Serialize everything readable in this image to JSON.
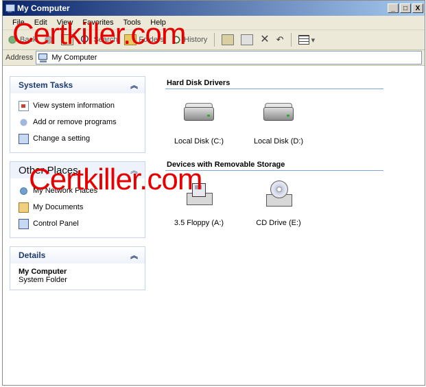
{
  "window": {
    "title": "My Computer",
    "controls": {
      "minimize": "_",
      "maximize": "□",
      "close": "X"
    }
  },
  "menu": [
    "File",
    "Edit",
    "View",
    "Favorites",
    "Tools",
    "Help"
  ],
  "toolbar": {
    "back": "Back",
    "search": "Search",
    "folders": "Folders",
    "history": "History"
  },
  "address": {
    "label": "Address",
    "value": "My Computer"
  },
  "left_panels": {
    "system_tasks": {
      "title": "System Tasks",
      "items": [
        "View system information",
        "Add or remove programs",
        "Change a setting"
      ]
    },
    "other_places": {
      "title": "Other Places",
      "items": [
        "My Network Places",
        "My Documents",
        "Control Panel"
      ]
    },
    "details": {
      "title": "Details",
      "name": "My Computer",
      "type": "System Folder"
    }
  },
  "groups": {
    "hard_disks": {
      "title": "Hard Disk Drivers",
      "items": [
        "Local Disk (C:)",
        "Local Disk (D:)"
      ]
    },
    "removable": {
      "title": "Devices with Removable Storage",
      "items": [
        "3.5 Floppy (A:)",
        "CD Drive  (E:)"
      ]
    }
  },
  "watermark": "Certkiller.com"
}
